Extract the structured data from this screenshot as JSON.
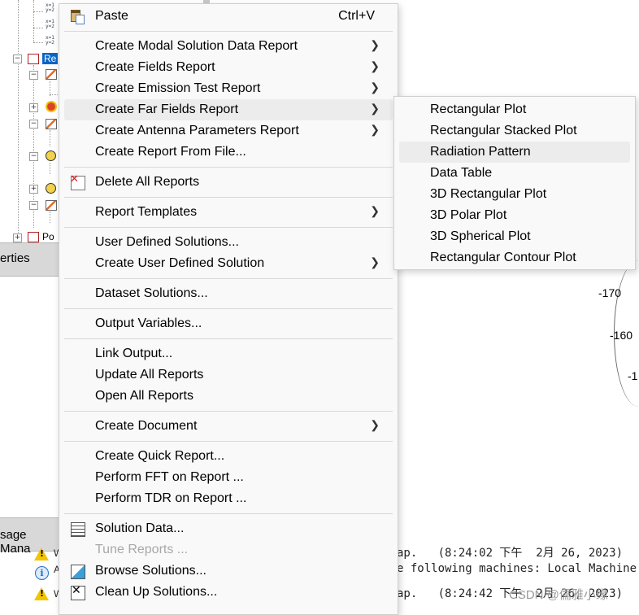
{
  "tree": {
    "selected_label": "Re",
    "ports_label": "Po"
  },
  "panels": {
    "properties_tab": "erties",
    "message_tab": "sage Mana"
  },
  "polar": {
    "labels": [
      "-170",
      "-160",
      "-1"
    ]
  },
  "messages": [
    {
      "icon": "warning-icon",
      "prefix": "W",
      "text": "ap.   (8:24:02 下午  2月 26, 2023)"
    },
    {
      "icon": "info-icon",
      "prefix": "A",
      "text": "e following machines: Local Machine."
    },
    {
      "icon": "warning-icon",
      "prefix": "W",
      "text": "ap.   (8:24:42 下午  2月 26, 2023)"
    }
  ],
  "watermark": "CSDN @儒雅小缘",
  "context_menu": {
    "items": [
      {
        "label": "Paste",
        "shortcut": "Ctrl+V",
        "icon": "paste-icon"
      },
      {
        "label": "Create Modal Solution Data Report",
        "submenu": true
      },
      {
        "label": "Create Fields Report",
        "submenu": true
      },
      {
        "label": "Create Emission Test Report",
        "submenu": true
      },
      {
        "label": "Create Far Fields Report",
        "submenu": true,
        "highlighted": true
      },
      {
        "label": "Create Antenna Parameters Report",
        "submenu": true
      },
      {
        "label": "Create Report From File..."
      },
      {
        "label": "Delete All Reports",
        "icon": "delete-reports-icon"
      },
      {
        "label": "Report Templates",
        "submenu": true
      },
      {
        "label": "User Defined Solutions..."
      },
      {
        "label": "Create User Defined Solution",
        "submenu": true
      },
      {
        "label": "Dataset Solutions..."
      },
      {
        "label": "Output Variables..."
      },
      {
        "label": "Link Output..."
      },
      {
        "label": "Update All Reports"
      },
      {
        "label": "Open All Reports"
      },
      {
        "label": "Create Document",
        "submenu": true
      },
      {
        "label": "Create Quick Report..."
      },
      {
        "label": "Perform FFT on Report ..."
      },
      {
        "label": "Perform TDR on Report ..."
      },
      {
        "label": "Solution Data...",
        "icon": "solution-data-icon"
      },
      {
        "label": "Tune Reports ...",
        "disabled": true
      },
      {
        "label": "Browse Solutions...",
        "icon": "browse-solutions-icon"
      },
      {
        "label": "Clean Up Solutions...",
        "icon": "clean-up-icon"
      }
    ]
  },
  "far_fields_submenu": {
    "items": [
      {
        "label": "Rectangular Plot"
      },
      {
        "label": "Rectangular Stacked Plot"
      },
      {
        "label": "Radiation Pattern",
        "highlighted": true
      },
      {
        "label": "Data Table"
      },
      {
        "label": "3D Rectangular Plot"
      },
      {
        "label": "3D Polar Plot"
      },
      {
        "label": "3D Spherical Plot"
      },
      {
        "label": "Rectangular Contour Plot"
      }
    ]
  }
}
